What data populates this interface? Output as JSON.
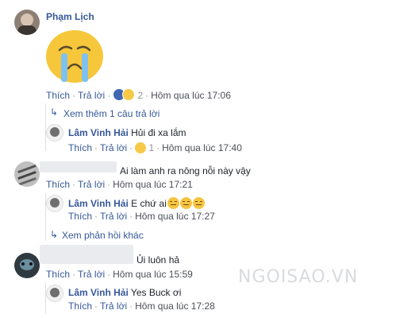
{
  "comments": [
    {
      "author": "Phạm Lịch",
      "sticker": "crying-face-sticker",
      "actions": {
        "like": "Thích",
        "reply": "Trả lời"
      },
      "reaction_count": "2",
      "time": "Hôm qua lúc 17:06",
      "more_replies": "Xem thêm 1 câu trả lời",
      "replies": [
        {
          "author": "Lâm Vinh Hải",
          "text": "Hủi đi xa lắm",
          "actions": {
            "like": "Thích",
            "reply": "Trả lời"
          },
          "reaction_count": "1",
          "time": "Hôm qua lúc 17:40"
        }
      ]
    },
    {
      "text": "Ai làm anh ra nông nỗi này vậy",
      "actions": {
        "like": "Thích",
        "reply": "Trả lời"
      },
      "time": "Hôm qua lúc 17:21",
      "more_replies": "Xem phản hồi khác",
      "replies": [
        {
          "author": "Lâm Vinh Hải",
          "text": "E chứ ai",
          "actions": {
            "like": "Thích",
            "reply": "Trả lời"
          },
          "time": "Hôm qua lúc 17:27"
        }
      ]
    },
    {
      "text": "Ủi luôn hả",
      "actions": {
        "like": "Thích",
        "reply": "Trả lời"
      },
      "time": "Hôm qua lúc 15:59",
      "replies": [
        {
          "author": "Lâm Vinh Hải",
          "text": "Yes Buck ơi",
          "actions": {
            "like": "Thích",
            "reply": "Trả lời"
          },
          "time": "Hôm qua lúc 17:28"
        }
      ]
    }
  ],
  "separator": "·",
  "watermark": "NGOISAO.VN",
  "colors": {
    "link": "#365899",
    "meta": "#90949c",
    "text": "#1d2129"
  }
}
